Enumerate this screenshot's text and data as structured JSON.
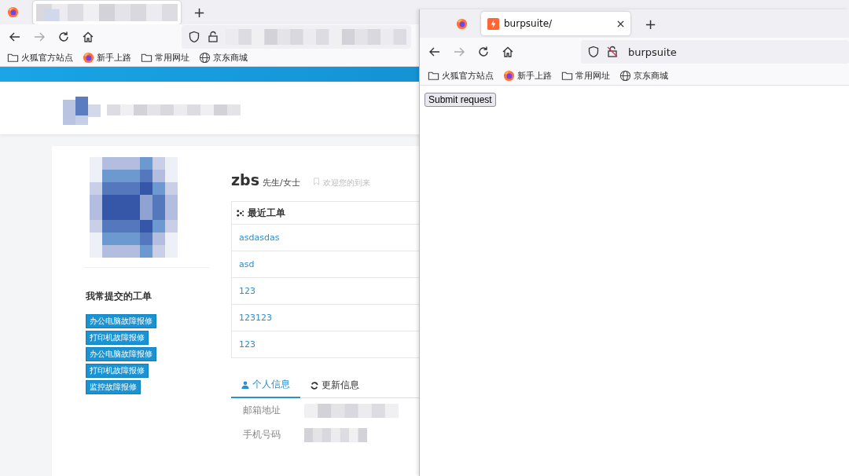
{
  "left_window": {
    "new_tab": "+",
    "tabs": [
      {
        "kind": "firefox",
        "selected": false
      },
      {
        "kind": "picture",
        "selected": true
      }
    ],
    "bookmarks": [
      {
        "kind": "folder",
        "label": "火狐官方站点"
      },
      {
        "kind": "firefox",
        "label": "新手上路"
      },
      {
        "kind": "folder",
        "label": "常用网址"
      },
      {
        "kind": "globe",
        "label": "京东商城"
      }
    ],
    "profile": {
      "name": "zbs",
      "salutation": "先生/女士",
      "welcome": "欢迎您的到来",
      "frequent_title": "我常提交的工单",
      "frequent_tags": [
        "办公电脑故障报修",
        "打印机故障报修",
        "办公电脑故障报修",
        "打印机故障报修",
        "监控故障报修"
      ],
      "recent_title": "最近工单",
      "recent": [
        "asdasdas",
        "asd",
        "123",
        "123123",
        "123"
      ],
      "tabs": [
        {
          "kind": "user",
          "label": "个人信息",
          "selected": true
        },
        {
          "kind": "refresh",
          "label": "更新信息",
          "selected": false
        }
      ],
      "fields": [
        {
          "label": "邮箱地址"
        },
        {
          "label": "手机号码"
        }
      ]
    }
  },
  "right_window": {
    "new_tab": "+",
    "tabs": [
      {
        "kind": "firefox",
        "selected": false
      },
      {
        "kind": "page",
        "label": "burpsuite/",
        "selected": true
      }
    ],
    "url": "burpsuite",
    "bookmarks": [
      {
        "kind": "folder",
        "label": "火狐官方站点"
      },
      {
        "kind": "firefox",
        "label": "新手上路"
      },
      {
        "kind": "folder",
        "label": "常用网址"
      },
      {
        "kind": "globe",
        "label": "京东商城"
      }
    ],
    "button": "Submit request"
  }
}
